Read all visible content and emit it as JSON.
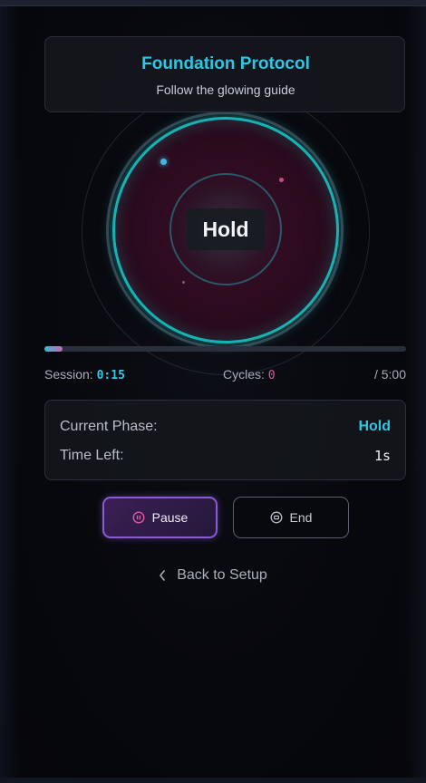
{
  "header": {
    "title": "Foundation Protocol",
    "subtitle": "Follow the glowing guide"
  },
  "orb": {
    "phase_label": "Hold"
  },
  "progress": {
    "fraction": 0.05
  },
  "stats": {
    "session_label": "Session:",
    "session_value": "0:15",
    "cycles_label": "Cycles:",
    "cycles_value": "0",
    "total": "/ 5:00"
  },
  "phase_card": {
    "current_phase_label": "Current Phase:",
    "current_phase_value": "Hold",
    "time_left_label": "Time Left:",
    "time_left_value": "1s"
  },
  "controls": {
    "pause_label": "Pause",
    "pause_icon": "pause-circle-icon",
    "end_label": "End",
    "end_icon": "stop-circle-icon"
  },
  "back": {
    "label": "Back to Setup",
    "icon": "chevron-left-icon"
  },
  "colors": {
    "accent_cyan": "#2ec6e2",
    "accent_pink": "#e056a0",
    "accent_purple": "#8a5bd6"
  }
}
